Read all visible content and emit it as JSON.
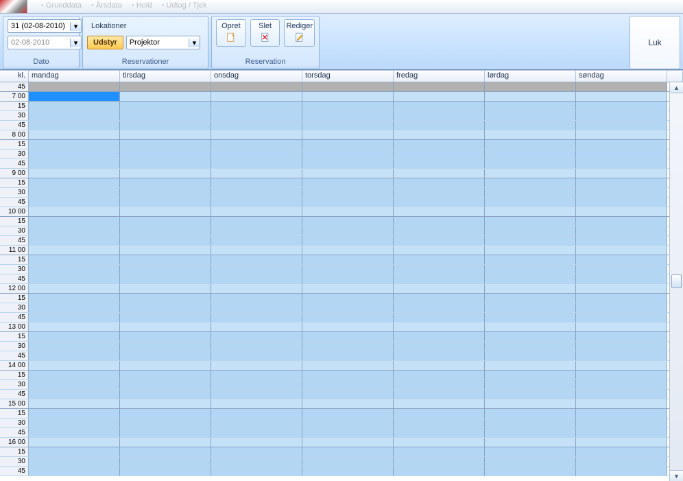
{
  "menubar": {
    "items": [
      "Grunddata",
      "Årsdata",
      "Hold",
      "Udtog / Tjek"
    ]
  },
  "ribbon": {
    "dato": {
      "label": "Dato",
      "week": "31 (02-08-2010)",
      "date": "02-08-2010"
    },
    "reservationer": {
      "label": "Reservationer",
      "lokationer": "Lokationer",
      "udstyr": "Udstyr",
      "type": "Projektor"
    },
    "reservation": {
      "label": "Reservation",
      "opret": "Opret",
      "slet": "Slet",
      "rediger": "Rediger"
    },
    "luk": "Luk"
  },
  "schedule": {
    "time_header": "kl.",
    "days": [
      "mandag",
      "tirsdag",
      "onsdag",
      "torsdag",
      "fredag",
      "lørdag",
      "søndag"
    ],
    "day_widths": [
      133,
      133,
      133,
      133,
      133,
      133,
      133
    ],
    "pre_row": "45",
    "hours": [
      7,
      8,
      9,
      10,
      11,
      12,
      13,
      14,
      15,
      16
    ],
    "minutes": [
      "00",
      "15",
      "30",
      "45"
    ],
    "selected": {
      "day_index": 0,
      "hour": 7,
      "minute": "00"
    }
  }
}
